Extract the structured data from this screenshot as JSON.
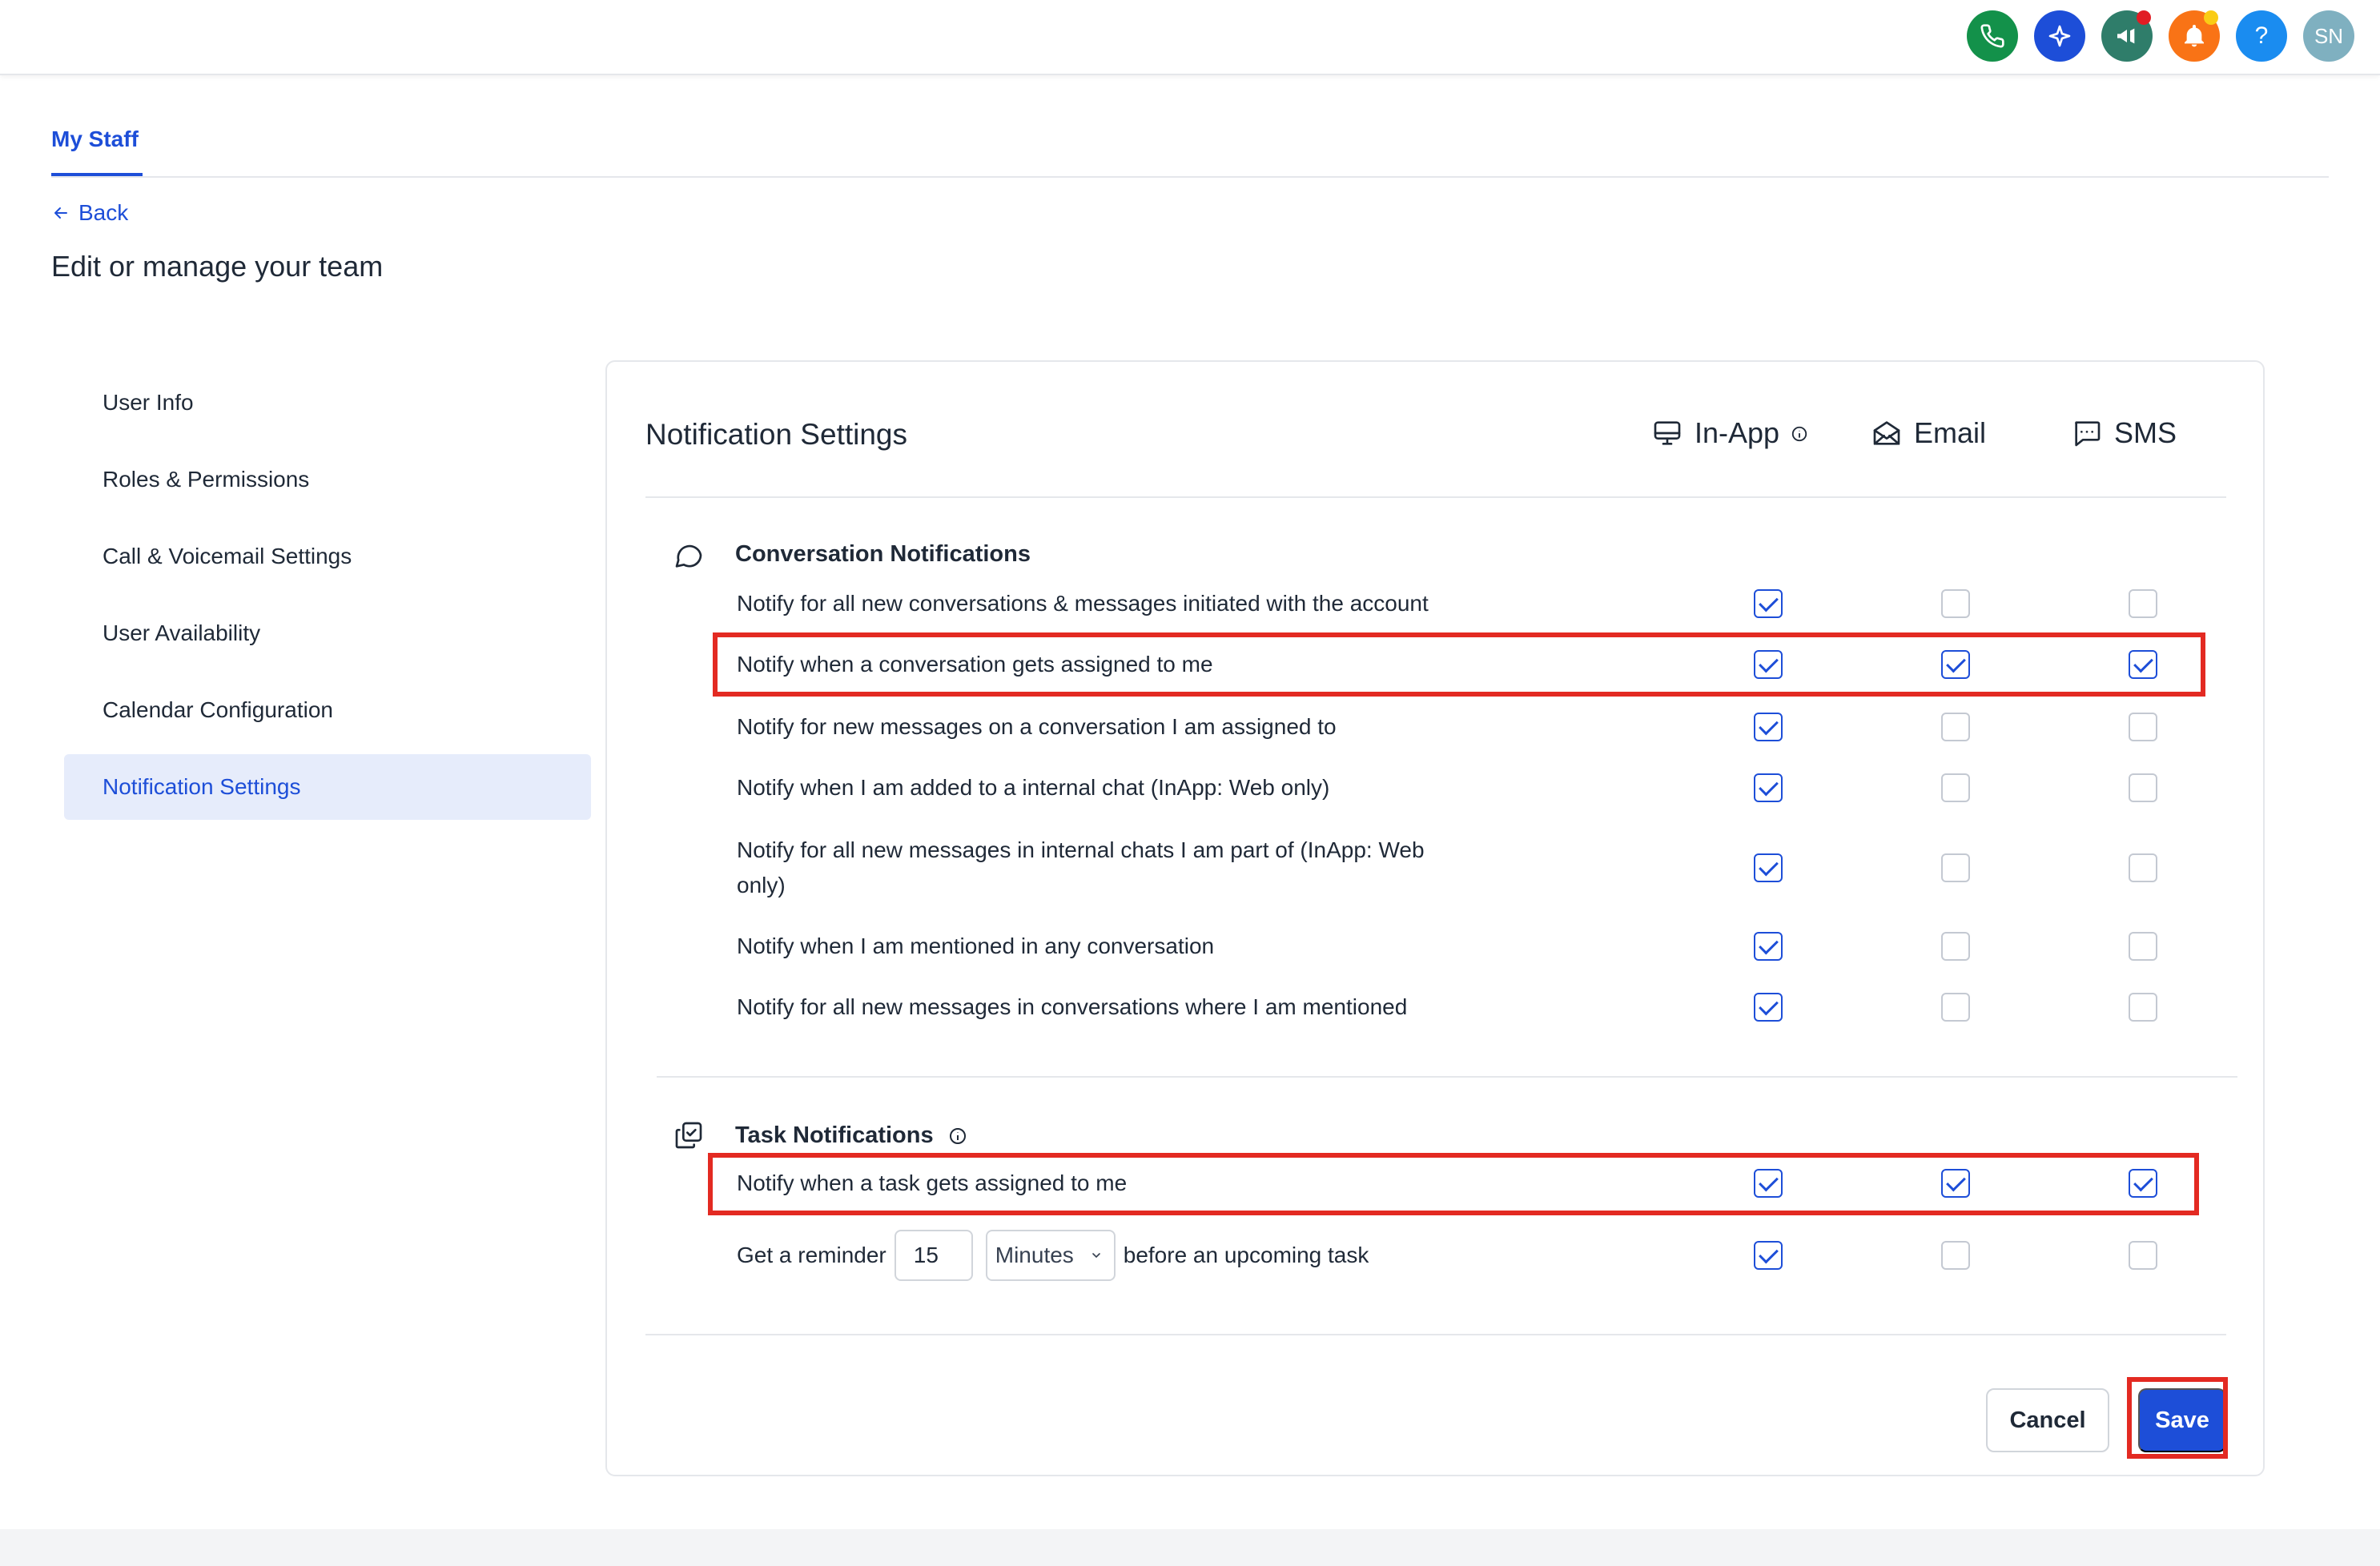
{
  "topbar": {
    "buttons": [
      {
        "name": "phone-icon",
        "color": "#13914a"
      },
      {
        "name": "sparkle-icon",
        "color": "#1d4ed8"
      },
      {
        "name": "megaphone-icon",
        "color": "#2f7d6a",
        "badge": "#e11d24"
      },
      {
        "name": "bell-icon",
        "color": "#f97316",
        "badge": "#facc15"
      },
      {
        "name": "help-icon",
        "color": "#1a8cf0",
        "label": "?"
      },
      {
        "name": "avatar",
        "color": "#7fb0c0",
        "label": "SN"
      }
    ]
  },
  "tabs": {
    "active": "My Staff"
  },
  "nav": {
    "back": "Back"
  },
  "page": {
    "title": "Edit or manage your team"
  },
  "sidebar": {
    "items": [
      {
        "label": "User Info",
        "active": false
      },
      {
        "label": "Roles & Permissions",
        "active": false
      },
      {
        "label": "Call & Voicemail Settings",
        "active": false
      },
      {
        "label": "User Availability",
        "active": false
      },
      {
        "label": "Calendar Configuration",
        "active": false
      },
      {
        "label": "Notification Settings",
        "active": true
      }
    ]
  },
  "settings": {
    "title": "Notification Settings",
    "columns": {
      "inapp": {
        "label": "In-App",
        "icon": "monitor-icon"
      },
      "email": {
        "label": "Email",
        "icon": "envelope-icon"
      },
      "sms": {
        "label": "SMS",
        "icon": "message-icon"
      }
    },
    "conversation": {
      "title": "Conversation Notifications",
      "rows": [
        {
          "label": "Notify for all new conversations & messages initiated with the account",
          "inapp": true,
          "email": false,
          "sms": false
        },
        {
          "label": "Notify when a conversation gets assigned to me",
          "inapp": true,
          "email": true,
          "sms": true,
          "highlighted": true
        },
        {
          "label": "Notify for new messages on a conversation I am assigned to",
          "inapp": true,
          "email": false,
          "sms": false
        },
        {
          "label": "Notify when I am added to a internal chat (InApp: Web only)",
          "inapp": true,
          "email": false,
          "sms": false
        },
        {
          "label": "Notify for all new messages in internal chats I am part of (InApp: Web",
          "label2": "only)",
          "inapp": true,
          "email": false,
          "sms": false
        },
        {
          "label": "Notify when I am mentioned in any conversation",
          "inapp": true,
          "email": false,
          "sms": false
        },
        {
          "label": "Notify for all new messages in conversations where I am mentioned",
          "inapp": true,
          "email": false,
          "sms": false
        }
      ]
    },
    "task": {
      "title": "Task Notifications",
      "rows": [
        {
          "label": "Notify when a task gets assigned to me",
          "inapp": true,
          "email": true,
          "sms": true,
          "highlighted": true
        }
      ],
      "reminder": {
        "prefix": "Get a reminder",
        "value": "15",
        "unit": "Minutes",
        "suffix": "before an upcoming task",
        "inapp": true,
        "email": false,
        "sms": false
      }
    }
  },
  "actions": {
    "cancel": "Cancel",
    "save": "Save"
  },
  "colors": {
    "accent": "#1d4ed8",
    "highlight": "#e32a22"
  }
}
